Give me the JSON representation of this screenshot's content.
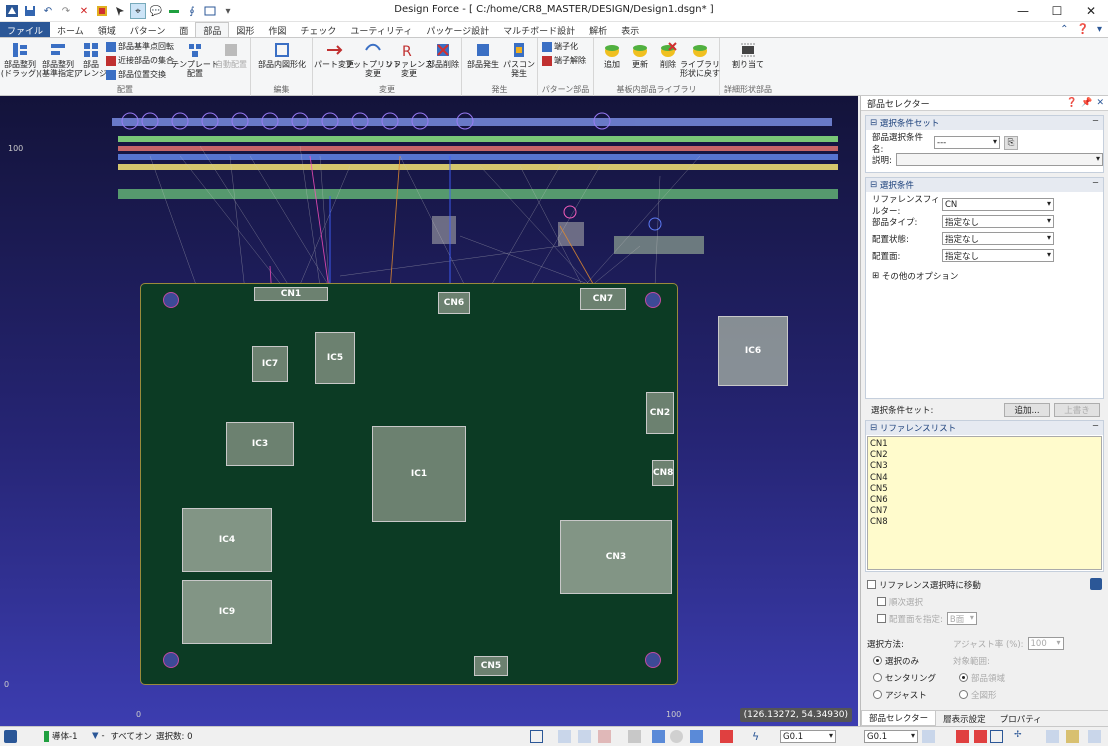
{
  "window": {
    "title": "Design Force - [ C:/home/CR8_MASTER/DESIGN/Design1.dsgn* ]"
  },
  "tabs": [
    "ファイル",
    "ホーム",
    "領域",
    "パターン",
    "面",
    "部品",
    "図形",
    "作図",
    "チェック",
    "ユーティリティ",
    "パッケージ設計",
    "マルチボード設計",
    "解析",
    "表示"
  ],
  "active_tab": "部品",
  "ribbon": {
    "placement": {
      "caption": "配置",
      "arrange_drag": "部品整列\n(ドラッグ)",
      "arrange_ref": "部品整列\n(基準指定)",
      "arrange": "部品\nアレンジ",
      "rotate_ref": "部品基準点回転",
      "near_set": "近接部品の集合",
      "swap": "部品位置交換",
      "template": "テンプレート\n配置",
      "auto": "自動配置"
    },
    "edit": {
      "caption": "編集",
      "outline": "部品内図形化"
    },
    "change": {
      "caption": "変更",
      "part": "パート変更",
      "footprint": "フットプリント\n変更",
      "reference": "リファレンス\n変更",
      "delete": "部品削除"
    },
    "generate": {
      "caption": "発生",
      "part_gen": "部品発生",
      "bypass": "パスコン\n発生"
    },
    "pattern": {
      "caption": "パターン部品",
      "terminal": "端子化",
      "unterminal": "端子解除"
    },
    "library": {
      "caption": "基板内部品ライブラリ",
      "add": "追加",
      "update": "更新",
      "delete": "削除",
      "revert": "ライブラリ\n形状に戻す"
    },
    "detail": {
      "caption": "詳細形状部品",
      "assign": "割り当て"
    }
  },
  "canvas": {
    "coord": "(126.13272, 54.34930)",
    "axis": {
      "y_top": "100",
      "y_zero": "0",
      "x_zero": "0",
      "x_hundred": "100"
    },
    "components": [
      "CN1",
      "CN6",
      "CN7",
      "IC6",
      "IC7",
      "IC5",
      "CN2",
      "IC3",
      "IC1",
      "CN8",
      "IC4",
      "CN3",
      "IC9",
      "CN5"
    ]
  },
  "panel": {
    "title": "部品セレクター",
    "condset_header": "選択条件セット",
    "condset_name_label": "部品選択条件名:",
    "condset_name_value": "---",
    "desc_label": "説明:",
    "cond_header": "選択条件",
    "filter_label": "リファレンスフィルター:",
    "filter_value": "CN",
    "type_label": "部品タイプ:",
    "type_value": "指定なし",
    "state_label": "配置状態:",
    "state_value": "指定なし",
    "side_label": "配置面:",
    "side_value": "指定なし",
    "other_options": "その他のオプション",
    "condset_footer_label": "選択条件セット:",
    "add_btn": "追加...",
    "overwrite_btn": "上書き",
    "reflist_header": "リファレンスリスト",
    "reflist": [
      "CN1",
      "CN2",
      "CN3",
      "CN4",
      "CN5",
      "CN6",
      "CN7",
      "CN8"
    ],
    "move_on_select": "リファレンス選択時に移動",
    "sequential": "順次選択",
    "specify_side": "配置面を指定:",
    "side_b": "B面",
    "method_label": "選択方法:",
    "method_opts": [
      "選択のみ",
      "センタリング",
      "アジャスト"
    ],
    "adjust_rate_label": "アジャスト率 (%):",
    "adjust_rate_value": "100",
    "target_label": "対象範囲:",
    "target_opts": [
      "部品領域",
      "全図形"
    ],
    "bottom_tabs": [
      "部品セレクター",
      "層表示設定",
      "プロパティ"
    ]
  },
  "status": {
    "layer": "導体-1",
    "filter": "すべてオン",
    "selected": "選択数: 0",
    "grid1": "G0.1",
    "grid2": "G0.1"
  }
}
